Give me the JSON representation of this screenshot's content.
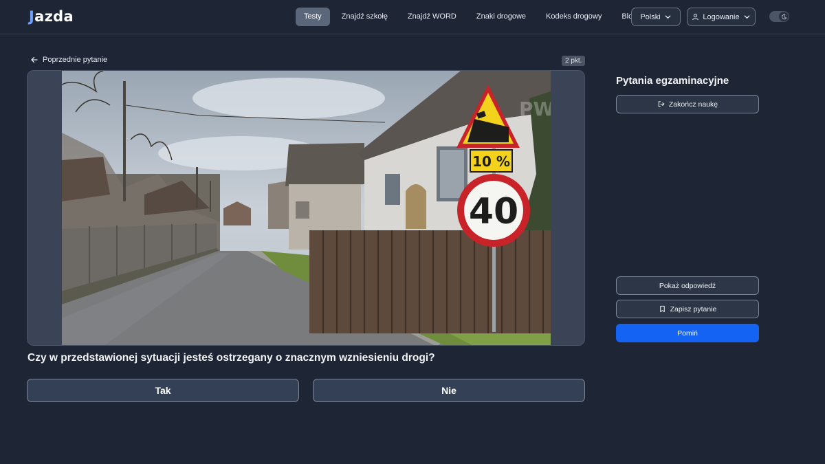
{
  "header": {
    "logo": "azda",
    "logo_prefix": "J",
    "nav": [
      {
        "label": "Testy",
        "active": true
      },
      {
        "label": "Znajdź szkołę",
        "active": false
      },
      {
        "label": "Znajdź WORD",
        "active": false
      },
      {
        "label": "Znaki drogowe",
        "active": false
      },
      {
        "label": "Kodeks drogowy",
        "active": false
      },
      {
        "label": "Blog",
        "active": false
      }
    ],
    "language": "Polski",
    "login": "Logowanie"
  },
  "question": {
    "back_label": "Poprzednie pytanie",
    "points": "2 pkt.",
    "text": "Czy w przedstawionej sytuacji jesteś ostrzegany o znacznym wzniesieniu drogi?",
    "answers": [
      "Tak",
      "Nie"
    ],
    "photo_signs": {
      "grade": "10 %",
      "speed_limit": "40",
      "watermark": "PWPW"
    }
  },
  "sidebar": {
    "title": "Pytania egzaminacyjne",
    "finish_label": "Zakończ naukę",
    "show_answer_label": "Pokaż odpowiedź",
    "save_label": "Zapisz pytanie",
    "skip_label": "Pomiń"
  },
  "colors": {
    "background": "#1e2636",
    "accent": "#1463f3",
    "logo_accent": "#6ea0ff"
  }
}
